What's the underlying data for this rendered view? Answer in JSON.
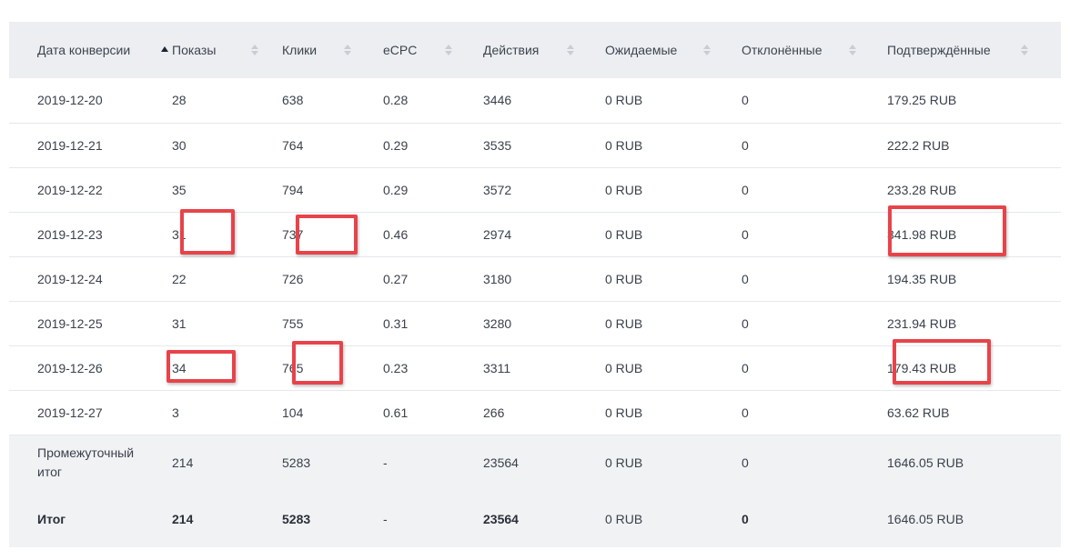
{
  "table": {
    "columns": [
      {
        "label": "Дата конверсии",
        "sort": "asc"
      },
      {
        "label": "Показы",
        "sort": "none"
      },
      {
        "label": "Клики",
        "sort": "none"
      },
      {
        "label": "eCPC",
        "sort": "none"
      },
      {
        "label": "Действия",
        "sort": "none"
      },
      {
        "label": "Ожидаемые",
        "sort": "none"
      },
      {
        "label": "Отклонённые",
        "sort": "none"
      },
      {
        "label": "Подтверждённые",
        "sort": "none"
      }
    ],
    "rows": [
      [
        "2019-12-20",
        "28",
        "638",
        "0.28",
        "3446",
        "0 RUB",
        "0",
        "179.25 RUB"
      ],
      [
        "2019-12-21",
        "30",
        "764",
        "0.29",
        "3535",
        "0 RUB",
        "0",
        "222.2 RUB"
      ],
      [
        "2019-12-22",
        "35",
        "794",
        "0.29",
        "3572",
        "0 RUB",
        "0",
        "233.28 RUB"
      ],
      [
        "2019-12-23",
        "31",
        "737",
        "0.46",
        "2974",
        "0 RUB",
        "0",
        "341.98 RUB"
      ],
      [
        "2019-12-24",
        "22",
        "726",
        "0.27",
        "3180",
        "0 RUB",
        "0",
        "194.35 RUB"
      ],
      [
        "2019-12-25",
        "31",
        "755",
        "0.31",
        "3280",
        "0 RUB",
        "0",
        "231.94 RUB"
      ],
      [
        "2019-12-26",
        "34",
        "765",
        "0.23",
        "3311",
        "0 RUB",
        "0",
        "179.43 RUB"
      ],
      [
        "2019-12-27",
        "3",
        "104",
        "0.61",
        "266",
        "0 RUB",
        "0",
        "63.62 RUB"
      ]
    ],
    "subtotal": [
      "Промежуточный итог",
      "214",
      "5283",
      "-",
      "23564",
      "0 RUB",
      "0",
      "1646.05 RUB"
    ],
    "total": [
      "Итог",
      "214",
      "5283",
      "-",
      "23564",
      "0 RUB",
      "0",
      "1646.05 RUB"
    ]
  },
  "annotations": {
    "color": "#e8434a",
    "highlighted_cells": [
      {
        "row": "2019-12-23",
        "column": "Показы",
        "value": "31"
      },
      {
        "row": "2019-12-23",
        "column": "Клики",
        "value": "737"
      },
      {
        "row": "2019-12-23",
        "column": "Подтверждённые",
        "value": "341.98 RUB"
      },
      {
        "row": "2019-12-26",
        "column": "Показы",
        "value": "34"
      },
      {
        "row": "2019-12-26",
        "column": "Клики",
        "value": "765"
      },
      {
        "row": "2019-12-26",
        "column": "Подтверждённые",
        "value": "179.43 RUB"
      }
    ]
  }
}
